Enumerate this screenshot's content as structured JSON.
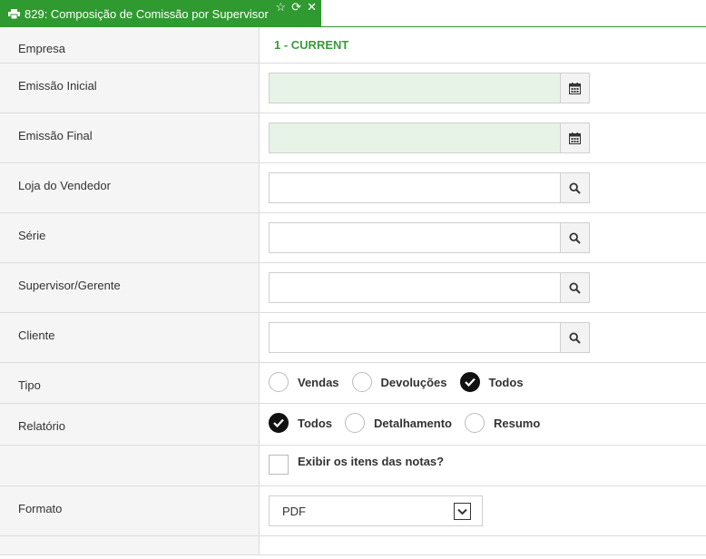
{
  "tab": {
    "title": "829: Composição de Comissão por Supervisor",
    "icons": [
      "print-icon",
      "star-icon",
      "refresh-icon",
      "close-icon"
    ]
  },
  "form": {
    "empresa": {
      "label": "Empresa",
      "value": "1 - CURRENT"
    },
    "emissao_inicial": {
      "label": "Emissão Inicial",
      "value": "",
      "icon": "calendar-icon"
    },
    "emissao_final": {
      "label": "Emissão Final",
      "value": "",
      "icon": "calendar-icon"
    },
    "loja_vendedor": {
      "label": "Loja do Vendedor",
      "value": "",
      "icon": "search-icon"
    },
    "serie": {
      "label": "Série",
      "value": "",
      "icon": "search-icon"
    },
    "supervisor": {
      "label": "Supervisor/Gerente",
      "value": "",
      "icon": "search-icon"
    },
    "cliente": {
      "label": "Cliente",
      "value": "",
      "icon": "search-icon"
    },
    "tipo": {
      "label": "Tipo",
      "options": [
        "Vendas",
        "Devoluções",
        "Todos"
      ],
      "selected": "Todos"
    },
    "relatorio": {
      "label": "Relatório",
      "options": [
        "Todos",
        "Detalhamento",
        "Resumo"
      ],
      "selected": "Todos"
    },
    "exibir_itens": {
      "label": "Exibir os itens das notas?",
      "checked": false
    },
    "formato": {
      "label": "Formato",
      "value": "PDF"
    }
  },
  "colors": {
    "accent": "#2f9a2f",
    "date_field_bg": "#e8f3e8",
    "label_bg": "#f5f5f5"
  }
}
